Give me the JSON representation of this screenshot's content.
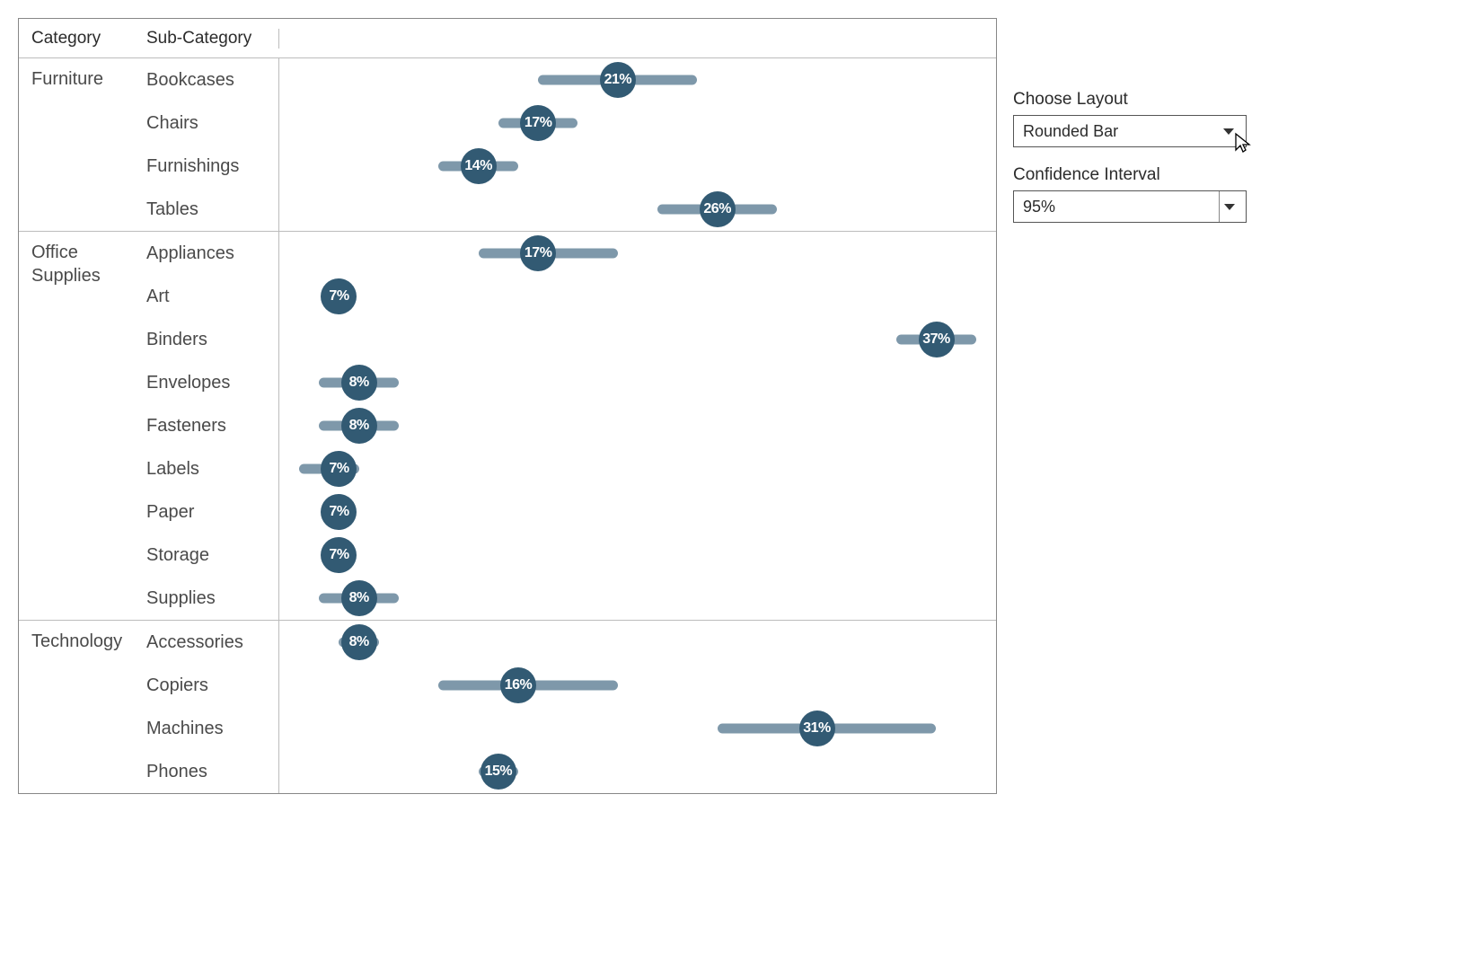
{
  "header": {
    "category": "Category",
    "sub_category": "Sub-Category"
  },
  "controls": {
    "layout_label": "Choose Layout",
    "layout_value": "Rounded Bar",
    "ci_label": "Confidence Interval",
    "ci_value": "95%"
  },
  "chart_data": {
    "type": "dot_ci",
    "xlabel": "",
    "ylabel": "",
    "xlim_pct": [
      4,
      40
    ],
    "groups": [
      {
        "category": "Furniture",
        "rows": [
          {
            "label": "Bookcases",
            "value_pct": 21,
            "ci_low": 17,
            "ci_high": 25,
            "display": "21%"
          },
          {
            "label": "Chairs",
            "value_pct": 17,
            "ci_low": 15,
            "ci_high": 19,
            "display": "17%"
          },
          {
            "label": "Furnishings",
            "value_pct": 14,
            "ci_low": 12,
            "ci_high": 16,
            "display": "14%"
          },
          {
            "label": "Tables",
            "value_pct": 26,
            "ci_low": 23,
            "ci_high": 29,
            "display": "26%"
          }
        ]
      },
      {
        "category": "Office Supplies",
        "rows": [
          {
            "label": "Appliances",
            "value_pct": 17,
            "ci_low": 14,
            "ci_high": 21,
            "display": "17%"
          },
          {
            "label": "Art",
            "value_pct": 7,
            "ci_low": 6.5,
            "ci_high": 7.5,
            "display": "7%"
          },
          {
            "label": "Binders",
            "value_pct": 37,
            "ci_low": 35,
            "ci_high": 39,
            "display": "37%"
          },
          {
            "label": "Envelopes",
            "value_pct": 8,
            "ci_low": 6,
            "ci_high": 10,
            "display": "8%"
          },
          {
            "label": "Fasteners",
            "value_pct": 8,
            "ci_low": 6,
            "ci_high": 10,
            "display": "8%"
          },
          {
            "label": "Labels",
            "value_pct": 7,
            "ci_low": 5,
            "ci_high": 8,
            "display": "7%"
          },
          {
            "label": "Paper",
            "value_pct": 7,
            "ci_low": 6.5,
            "ci_high": 7.5,
            "display": "7%"
          },
          {
            "label": "Storage",
            "value_pct": 7,
            "ci_low": 6.5,
            "ci_high": 7.5,
            "display": "7%"
          },
          {
            "label": "Supplies",
            "value_pct": 8,
            "ci_low": 6,
            "ci_high": 10,
            "display": "8%"
          }
        ]
      },
      {
        "category": "Technology",
        "rows": [
          {
            "label": "Accessories",
            "value_pct": 8,
            "ci_low": 7,
            "ci_high": 9,
            "display": "8%"
          },
          {
            "label": "Copiers",
            "value_pct": 16,
            "ci_low": 12,
            "ci_high": 21,
            "display": "16%"
          },
          {
            "label": "Machines",
            "value_pct": 31,
            "ci_low": 26,
            "ci_high": 37,
            "display": "31%"
          },
          {
            "label": "Phones",
            "value_pct": 15,
            "ci_low": 14,
            "ci_high": 16,
            "display": "15%"
          }
        ]
      }
    ]
  }
}
